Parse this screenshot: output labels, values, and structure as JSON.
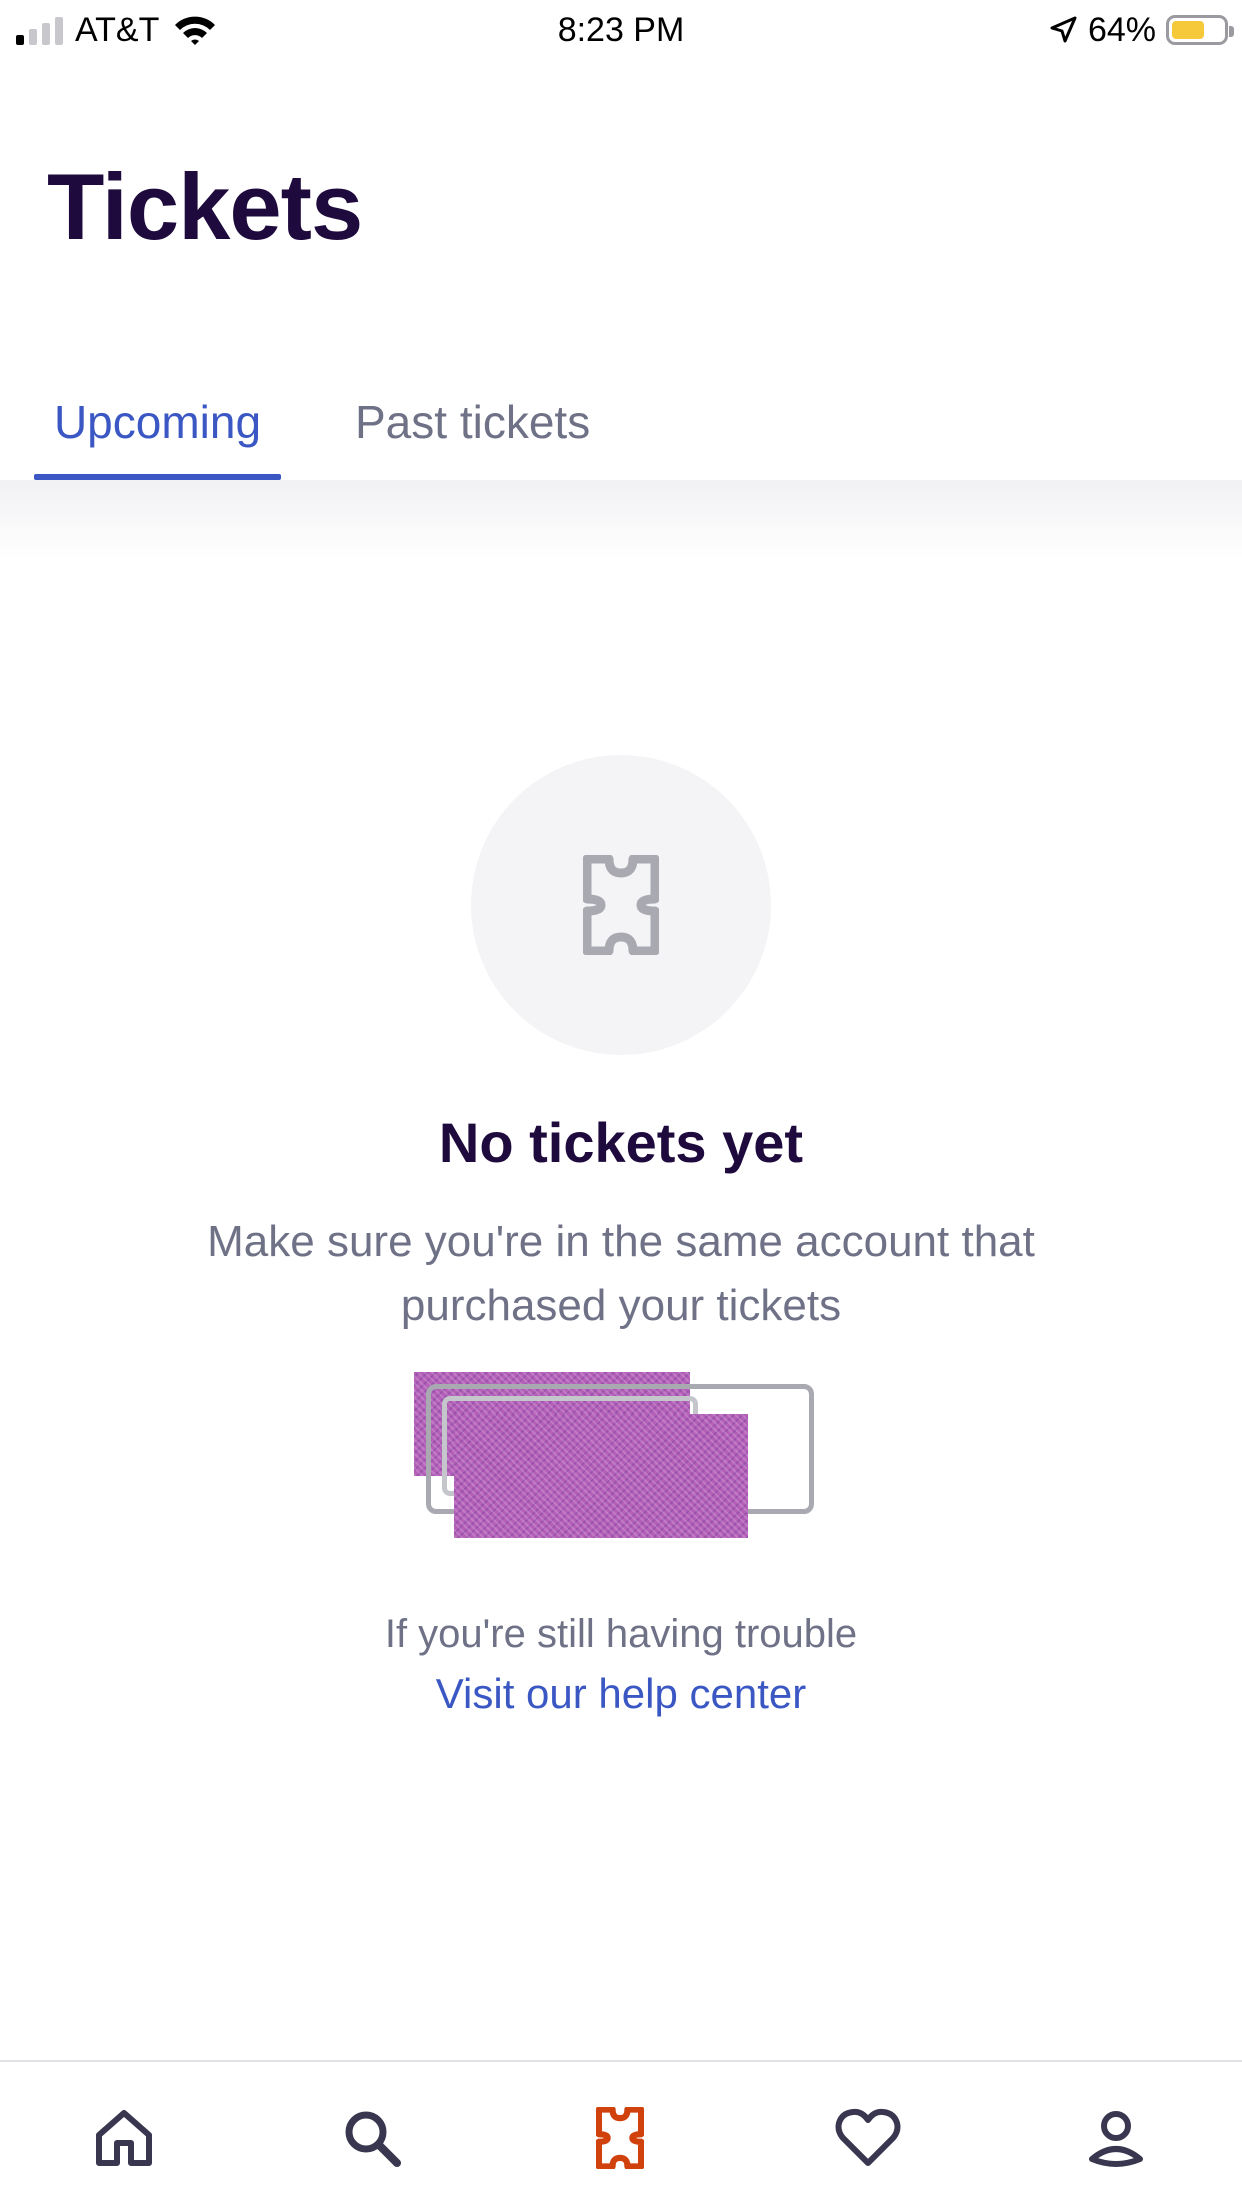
{
  "status_bar": {
    "carrier": "AT&T",
    "time": "8:23 PM",
    "battery_percent": "64%",
    "signal_bars_active": 1,
    "signal_bars_total": 4,
    "battery_level": 0.64,
    "battery_color": "#f5c93a",
    "icons": [
      "signal-icon",
      "wifi-icon",
      "location-icon",
      "battery-charging-icon"
    ]
  },
  "header": {
    "title": "Tickets"
  },
  "tabs": [
    {
      "label": "Upcoming",
      "active": true
    },
    {
      "label": "Past tickets",
      "active": false
    }
  ],
  "empty_state": {
    "icon": "ticket-icon",
    "title": "No tickets yet",
    "description": "Make sure you're in the same account that purchased your tickets",
    "trouble_text": "If you're still having trouble",
    "help_link": "Visit our help center"
  },
  "bottom_nav": {
    "items": [
      {
        "icon": "home-icon",
        "active": false
      },
      {
        "icon": "search-icon",
        "active": false
      },
      {
        "icon": "ticket-icon",
        "active": true
      },
      {
        "icon": "heart-icon",
        "active": false
      },
      {
        "icon": "profile-icon",
        "active": false
      }
    ]
  },
  "colors": {
    "title": "#1e0a3c",
    "accent": "#3a57c4",
    "muted_text": "#6f7287",
    "active_nav": "#d1410c",
    "nav_icon": "#39364f"
  }
}
